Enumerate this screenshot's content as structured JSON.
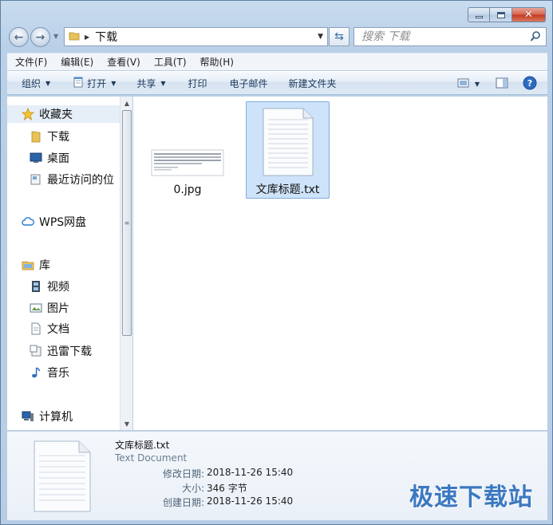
{
  "window": {
    "caption": {
      "minimize": "_",
      "maximize": "□",
      "close": "✕"
    }
  },
  "address": {
    "path": "下载",
    "search_placeholder": "搜索 下载"
  },
  "menu": [
    "文件(F)",
    "编辑(E)",
    "查看(V)",
    "工具(T)",
    "帮助(H)"
  ],
  "commands": {
    "organize": "组织",
    "open": "打开",
    "share": "共享",
    "print": "打印",
    "email": "电子邮件",
    "new_folder": "新建文件夹"
  },
  "nav_tree": [
    {
      "label": "收藏夹",
      "icon": "star-icon"
    },
    {
      "label": "下载",
      "icon": "download-folder-icon"
    },
    {
      "label": "桌面",
      "icon": "desktop-icon"
    },
    {
      "label": "最近访问的位",
      "icon": "recent-places-icon"
    },
    {
      "label": "WPS网盘",
      "icon": "cloud-icon"
    },
    {
      "label": "库",
      "icon": "library-icon"
    },
    {
      "label": "视频",
      "icon": "video-icon"
    },
    {
      "label": "图片",
      "icon": "picture-icon"
    },
    {
      "label": "文档",
      "icon": "document-icon"
    },
    {
      "label": "迅雷下载",
      "icon": "xunlei-icon"
    },
    {
      "label": "音乐",
      "icon": "music-icon"
    },
    {
      "label": "计算机",
      "icon": "computer-icon"
    }
  ],
  "files": [
    {
      "name": "0.jpg",
      "type": "image",
      "selected": false
    },
    {
      "name": "文库标题.txt",
      "type": "text",
      "selected": true
    }
  ],
  "details": {
    "name": "文库标题.txt",
    "type": "Text Document",
    "modified_label": "修改日期:",
    "modified": "2018-11-26 15:40",
    "size_label": "大小:",
    "size": "346 字节",
    "created_label": "创建日期:",
    "created": "2018-11-26 15:40"
  },
  "watermark": "极速下载站",
  "colors": {
    "accent": "#3b78c0",
    "selection": "#cde3f9",
    "chrome": "#b9d0e8"
  }
}
